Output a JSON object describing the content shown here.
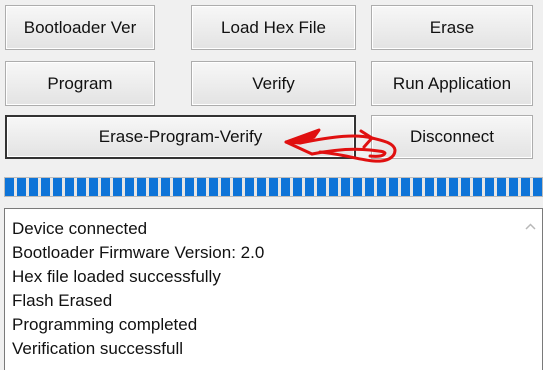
{
  "buttons": {
    "bootloader_ver": "Bootloader Ver",
    "load_hex_file": "Load Hex File",
    "erase": "Erase",
    "program": "Program",
    "verify": "Verify",
    "run_application": "Run Application",
    "erase_program_verify": "Erase-Program-Verify",
    "disconnect": "Disconnect"
  },
  "progress": {
    "value": 1.0,
    "color": "#0e74d8"
  },
  "log": {
    "lines": [
      "Device connected",
      "Bootloader Firmware Version: 2.0",
      "Hex file loaded successfully",
      "Flash Erased",
      "Programming completed",
      "Verification successfull"
    ]
  },
  "annotation": {
    "arrow_color": "#e01010",
    "arrow_icon": "curved-arrow-icon"
  },
  "icons": {
    "scroll_up": "chevron-up-icon"
  }
}
